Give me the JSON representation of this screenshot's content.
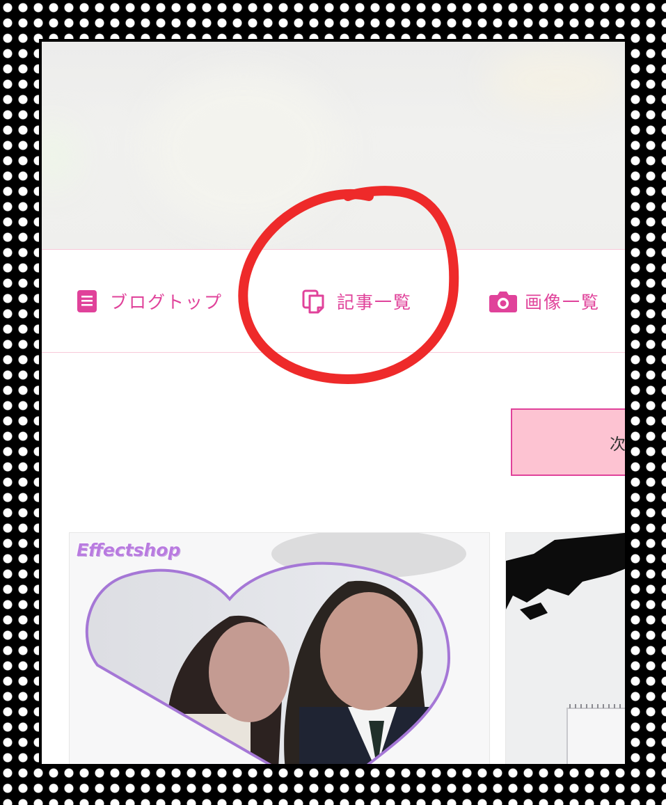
{
  "nav": {
    "items": [
      {
        "label": "ブログトップ",
        "icon": "document-list-icon"
      },
      {
        "label": "記事一覧",
        "icon": "copy-pages-icon"
      },
      {
        "label": "画像一覧",
        "icon": "camera-icon"
      }
    ]
  },
  "pagination": {
    "next_label": "次"
  },
  "thumbnails": {
    "watermark": "Effectshop"
  },
  "colors": {
    "accent": "#e0429a",
    "button_bg": "#fdc3d2",
    "annotation": "#ee2a2a",
    "border": "#f7c9d8"
  }
}
